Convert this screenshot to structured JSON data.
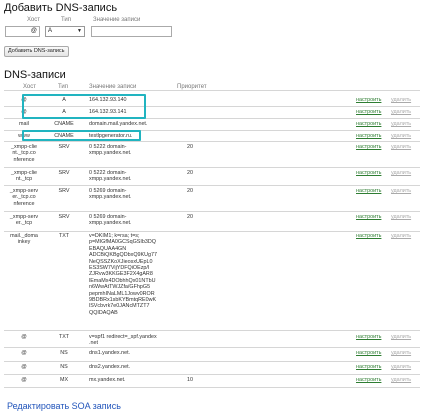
{
  "add_form": {
    "title": "Добавить DNS-запись",
    "host_label": "Хост",
    "type_label": "Тип",
    "value_label": "Значение записи",
    "host_value": "@",
    "type_value": "A",
    "value_value": "",
    "submit_label": "Добавить DNS-запись"
  },
  "records": {
    "title": "DNS-записи",
    "columns": {
      "host": "Хост",
      "type": "Тип",
      "value": "Значение записи",
      "priority": "Приоритет"
    },
    "edit_label": "настроить",
    "delete_label": "удалить",
    "rows": [
      {
        "host": "@",
        "type": "A",
        "value": "164.132.93.140",
        "priority": ""
      },
      {
        "host": "@",
        "type": "A",
        "value": "164.132.93.141",
        "priority": ""
      },
      {
        "host": "mail",
        "type": "CNAME",
        "value": "domain.mail.yandex.net.",
        "priority": ""
      },
      {
        "host": "www",
        "type": "CNAME",
        "value": "testlpgenerator.ru.",
        "priority": ""
      },
      {
        "host": "_xmpp-clie\nnt._tcp.co\nnference",
        "type": "SRV",
        "value": "0 5222 domain-\nxmpp.yandex.net.",
        "priority": "20"
      },
      {
        "host": "_xmpp-clie\nnt._tcp",
        "type": "SRV",
        "value": "0 5222 domain-\nxmpp.yandex.net.",
        "priority": "20"
      },
      {
        "host": "_xmpp-serv\ner._tcp.co\nnference",
        "type": "SRV",
        "value": "0 5269 domain-\nxmpp.yandex.net.",
        "priority": "20"
      },
      {
        "host": "_xmpp-serv\ner._tcp",
        "type": "SRV",
        "value": "0 5269 domain-\nxmpp.yandex.net.",
        "priority": "20"
      },
      {
        "host": "mail._doma\ninkey",
        "type": "TXT",
        "value": "v=DKIM1; k=rsa; t=s;\np=MIGfMA0GCSqGSIb3DQ\nEBAQUAA4GN\nADCBiQKBgQDbxQ9KUg77\nNeQSSZKoXJieosxUEpL0\nES3SW7VijYDFQiOEzp/I\nZJRvw3KKGE3F2X4gAR8\nlEmaMx4DObhhQx01NTbU\nn6WwAtTWJZfa/GFhpG5\npepmhINaLML1Jowv0ROR\n9BDBRx1sbKYBmtqRE0wK\nlSVcbvrk7e0JANcMTZT7\nQQIDAQAB",
        "priority": ""
      },
      {
        "host": "@",
        "type": "TXT",
        "value": "v=spf1 redirect=_spf.yandex\n.net",
        "priority": ""
      },
      {
        "host": "@",
        "type": "NS",
        "value": "dns1.yandex.net.",
        "priority": ""
      },
      {
        "host": "@",
        "type": "NS",
        "value": "dns2.yandex.net.",
        "priority": ""
      },
      {
        "host": "@",
        "type": "MX",
        "value": "mx.yandex.net.",
        "priority": "10"
      }
    ]
  },
  "soa_link": "Редактировать SOA запись"
}
